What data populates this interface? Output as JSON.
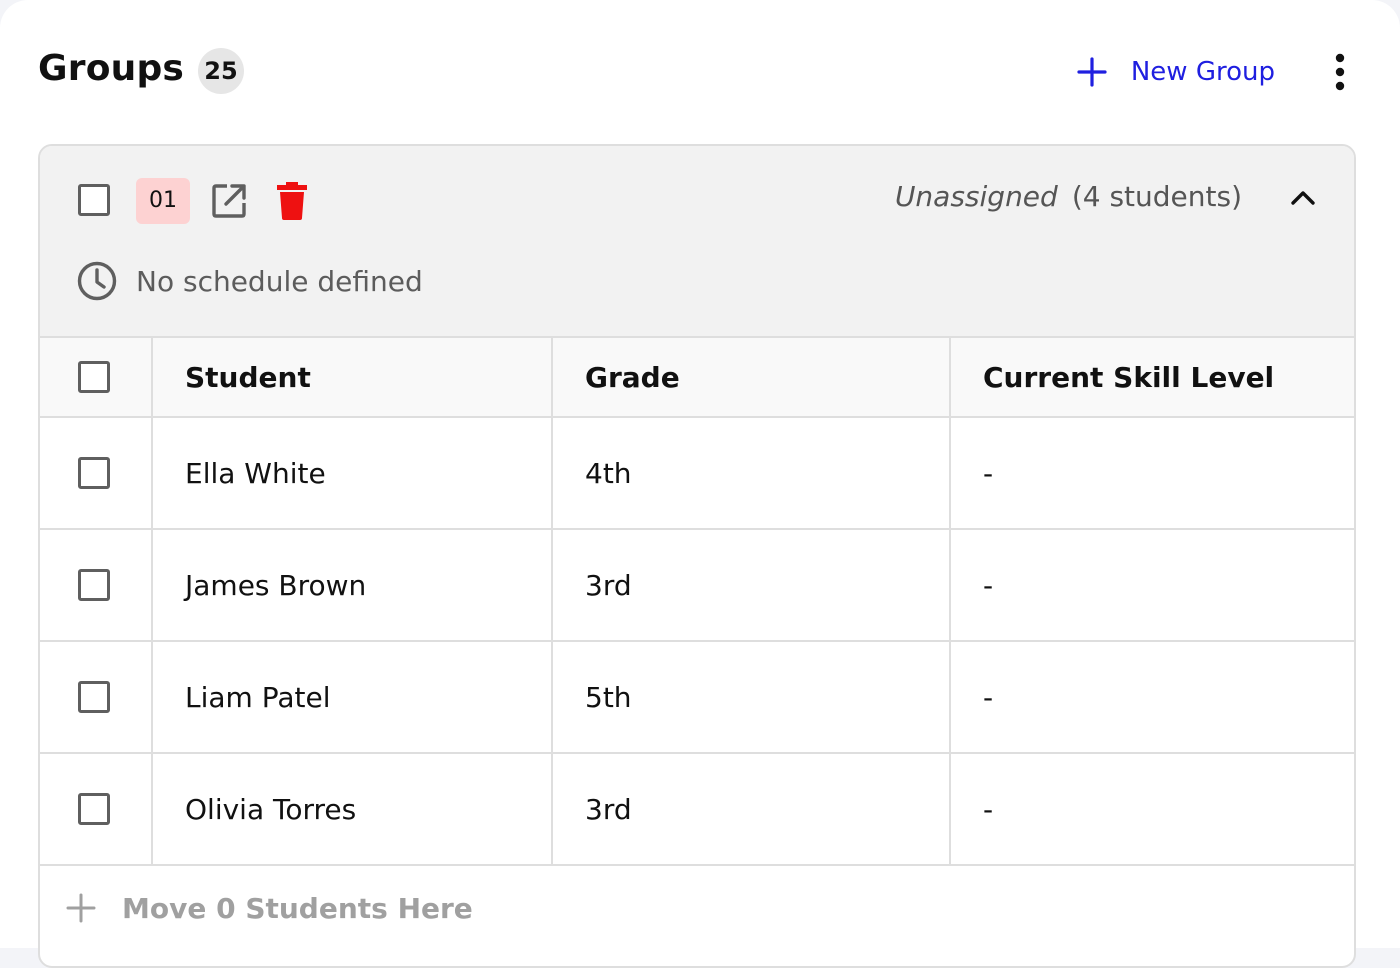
{
  "header": {
    "title": "Groups",
    "count": "25",
    "new_group_label": "New Group"
  },
  "group": {
    "number": "01",
    "assignment": "Unassigned",
    "student_count": "(4 students)",
    "schedule": "No schedule defined",
    "columns": [
      "Student",
      "Grade",
      "Current Skill Level"
    ],
    "rows": [
      {
        "student": "Ella White",
        "grade": "4th",
        "skill": "-"
      },
      {
        "student": "James Brown",
        "grade": "3rd",
        "skill": "-"
      },
      {
        "student": "Liam Patel",
        "grade": "5th",
        "skill": "-"
      },
      {
        "student": "Olivia Torres",
        "grade": "3rd",
        "skill": "-"
      }
    ],
    "move_label": "Move 0 Students Here"
  },
  "colors": {
    "accent": "#1f1fe0",
    "danger": "#ee1111",
    "badge_bg": "#fdd2d2"
  },
  "icons": [
    "plus-icon",
    "kebab-menu-icon",
    "external-link-icon",
    "trash-icon",
    "chevron-up-icon",
    "clock-icon"
  ]
}
